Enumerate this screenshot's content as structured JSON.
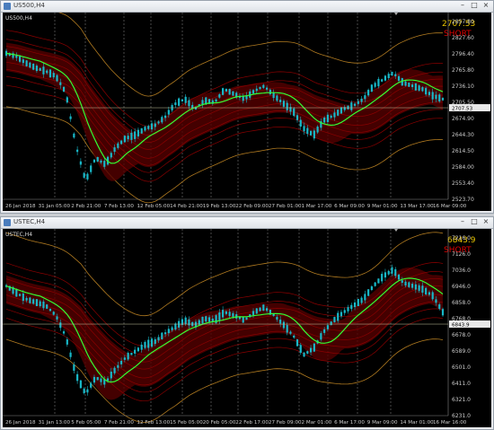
{
  "colors": {
    "background": "#000000",
    "candle": "#18b8c8",
    "band_red": "#8a0000",
    "band_dark": "#550000",
    "ma_green": "#33ff33",
    "band_orange": "#b07a20",
    "grid": "#7a7a7a",
    "signal": "#e00000",
    "price_label": "#e8c400"
  },
  "windows": [
    {
      "title": "US500,H4",
      "symbol_label": "US500,H4",
      "current_price": "2707.53",
      "signal": "SHORT",
      "price_axis": [
        "2857.80",
        "2827.60",
        "2796.40",
        "2765.80",
        "2736.10",
        "2705.50",
        "2674.90",
        "2644.30",
        "2614.50",
        "2584.00",
        "2553.40",
        "2523.70"
      ],
      "last_price_tag": "2707.53",
      "time_axis": [
        "26 Jan 2018",
        "31 Jan 05:00",
        "2 Feb 21:00",
        "7 Feb 13:00",
        "12 Feb 05:00",
        "14 Feb 21:00",
        "19 Feb 13:00",
        "22 Feb 09:00",
        "27 Feb 01:00",
        "1 Mar 17:00",
        "6 Mar 09:00",
        "9 Mar 01:00",
        "13 Mar 17:00",
        "16 Mar 09:00"
      ],
      "series_profile": [
        0.86,
        0.84,
        0.8,
        0.77,
        0.75,
        0.72,
        0.62,
        0.3,
        0.08,
        0.22,
        0.18,
        0.28,
        0.34,
        0.36,
        0.4,
        0.42,
        0.47,
        0.55,
        0.58,
        0.52,
        0.57,
        0.56,
        0.64,
        0.61,
        0.58,
        0.63,
        0.66,
        0.6,
        0.55,
        0.5,
        0.4,
        0.36,
        0.45,
        0.48,
        0.52,
        0.54,
        0.58,
        0.66,
        0.7,
        0.74,
        0.68,
        0.66,
        0.64,
        0.6,
        0.58
      ]
    },
    {
      "title": "USTEC,H4",
      "symbol_label": "USTEC,H4",
      "current_price": "6843.9",
      "signal": "SHORT",
      "price_axis": [
        "7216.0",
        "7126.0",
        "7036.0",
        "6946.0",
        "6858.0",
        "6768.0",
        "6678.0",
        "6589.0",
        "6501.0",
        "6411.0",
        "6321.0",
        "6231.0"
      ],
      "last_price_tag": "6843.9",
      "time_axis": [
        "26 Jan 2018",
        "31 Jan 13:00",
        "5 Feb 05:00",
        "7 Feb 21:00",
        "12 Feb 13:00",
        "15 Feb 05:00",
        "20 Feb 05:00",
        "22 Feb 17:00",
        "27 Feb 09:00",
        "2 Mar 01:00",
        "6 Mar 17:00",
        "9 Mar 09:00",
        "14 Mar 01:00",
        "16 Mar 16:00"
      ],
      "series_profile": [
        0.76,
        0.72,
        0.68,
        0.66,
        0.64,
        0.58,
        0.45,
        0.22,
        0.1,
        0.2,
        0.17,
        0.25,
        0.32,
        0.36,
        0.4,
        0.42,
        0.47,
        0.51,
        0.55,
        0.52,
        0.56,
        0.55,
        0.6,
        0.58,
        0.55,
        0.6,
        0.63,
        0.58,
        0.52,
        0.45,
        0.34,
        0.38,
        0.48,
        0.55,
        0.6,
        0.64,
        0.68,
        0.76,
        0.82,
        0.86,
        0.78,
        0.76,
        0.74,
        0.7,
        0.6
      ]
    }
  ]
}
